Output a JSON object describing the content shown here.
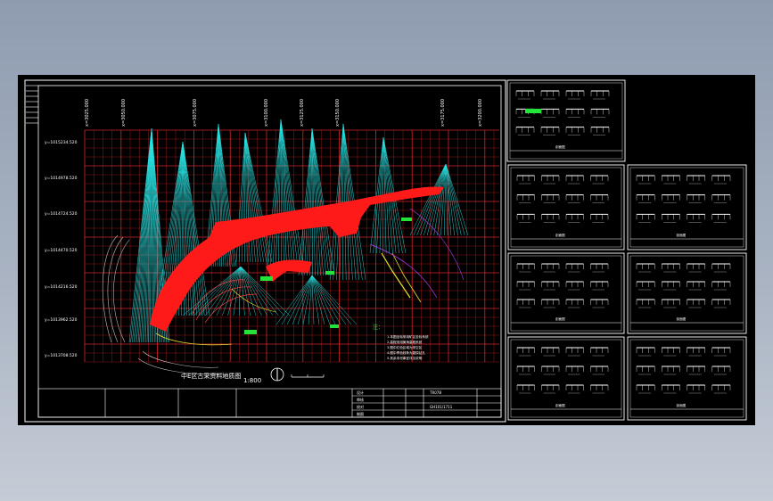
{
  "viewer": {
    "background_colors": [
      "#8f9cb0",
      "#c4ccd6"
    ],
    "canvas_color": "#000000"
  },
  "main_drawing": {
    "grid_coordinates": {
      "top": [
        "x=3025.000",
        "x=3050.000",
        "x=3075.000",
        "x=3100.000",
        "x=3125.000",
        "x=3150.000",
        "x=3175.000",
        "x=3200.000"
      ],
      "left": [
        "y=1015234.520",
        "y=1014978.520",
        "y=1014724.520",
        "y=1014470.520",
        "y=1014216.520",
        "y=1013962.520",
        "y=1013708.520"
      ]
    },
    "title": "中E区古采资料地质图",
    "scale": "1:800",
    "notes_heading": "注：",
    "notes": [
      "1.本图坐标采用矿区坐标系统",
      "2.高程采用黄海高程系统",
      "3.图中红色区域为采空区",
      "4.图中青色线条为勘探钻孔",
      "5.其余未尽事宜详见说明"
    ],
    "title_block": {
      "labels": [
        "设计",
        "审核",
        "校对",
        "制图"
      ],
      "project": "TR07B",
      "drawing_no": "GH101/1711"
    },
    "colors": {
      "grid": "#d4262a",
      "boreholes": "#27e3e3",
      "goaf": "#ff1a1a",
      "frame": "#ffffff",
      "highlight": "#23e23a"
    }
  },
  "sheets": [
    {
      "id": "sheet-1",
      "label": "剖面图"
    },
    {
      "id": "sheet-2",
      "label": "剖面图"
    },
    {
      "id": "sheet-3",
      "label": "剖面图"
    },
    {
      "id": "sheet-4",
      "label": "剖面图"
    },
    {
      "id": "sheet-5",
      "label": "剖面图"
    },
    {
      "id": "sheet-6",
      "label": "剖面图"
    },
    {
      "id": "sheet-7",
      "label": "剖面图"
    }
  ]
}
